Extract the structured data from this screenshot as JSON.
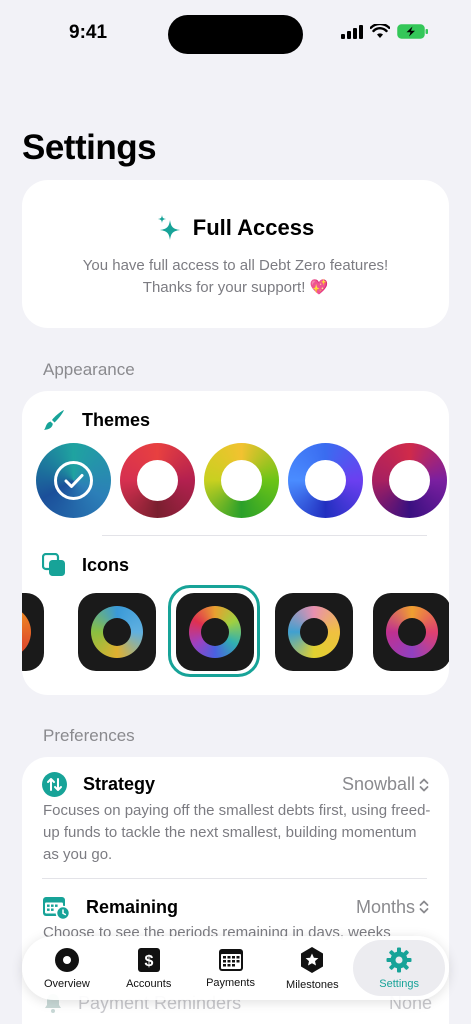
{
  "status_bar": {
    "time": "9:41"
  },
  "page": {
    "title": "Settings"
  },
  "access": {
    "title": "Full Access",
    "line1": "You have full access to all Debt Zero features!",
    "line2": "Thanks for your support! 💖"
  },
  "appearance": {
    "section_label": "Appearance",
    "themes_label": "Themes",
    "icons_label": "Icons"
  },
  "preferences": {
    "section_label": "Preferences",
    "strategy": {
      "label": "Strategy",
      "value": "Snowball",
      "desc": "Focuses on paying off the smallest debts first, using freed-up funds to tackle the next smallest, building momentum as you go."
    },
    "remaining": {
      "label": "Remaining",
      "value": "Months",
      "desc": "Choose to see the periods remaining in days, weeks"
    },
    "payment_reminders": {
      "label": "Payment Reminders",
      "value": "None"
    }
  },
  "tabs": [
    {
      "label": "Overview",
      "icon": "overview-icon"
    },
    {
      "label": "Accounts",
      "icon": "dollar-icon"
    },
    {
      "label": "Payments",
      "icon": "calendar-icon"
    },
    {
      "label": "Milestones",
      "icon": "star-hexagon-icon"
    },
    {
      "label": "Settings",
      "icon": "gear-icon"
    }
  ],
  "colors": {
    "accent": "#17a398",
    "background": "#f2f2f7"
  }
}
